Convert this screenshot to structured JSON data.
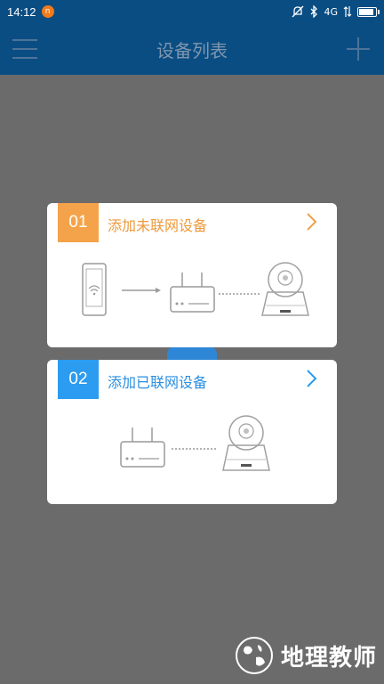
{
  "status": {
    "time": "14:12",
    "notif": "n",
    "network": "4G"
  },
  "header": {
    "title": "设备列表"
  },
  "cards": [
    {
      "number": "01",
      "title": "添加未联网设备",
      "accent": "#f5a34a"
    },
    {
      "number": "02",
      "title": "添加已联网设备",
      "accent": "#2b9cf0"
    }
  ],
  "watermark": {
    "text": "地理教师"
  },
  "colors": {
    "header_bg": "#0a4d83",
    "overlay_bg": "#6b6b6b",
    "line_gray": "#9a9a9a"
  }
}
